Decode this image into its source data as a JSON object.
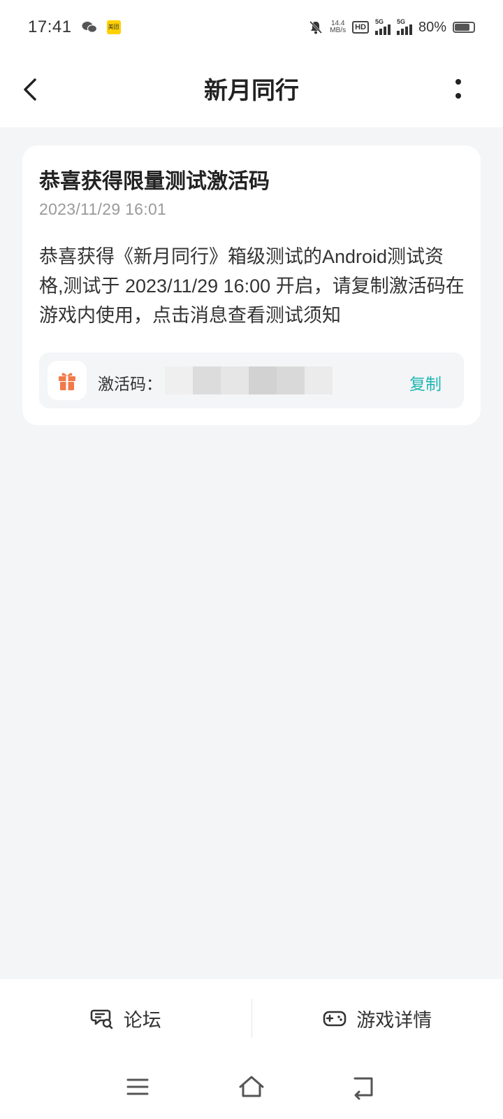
{
  "status_bar": {
    "time": "17:41",
    "app_icons": [
      "wechat-icon",
      "meituan-icon"
    ],
    "meituan_label": "美团",
    "net_speed_value": "14.4",
    "net_speed_unit": "MB/s",
    "hd_label": "HD",
    "signal_1_label": "5G",
    "signal_2_label": "5G",
    "battery": "80%",
    "battery_level": 0.8
  },
  "header": {
    "title": "新月同行",
    "back_icon": "back-arrow-icon",
    "more_icon": "more-vertical-icon"
  },
  "message": {
    "title": "恭喜获得限量测试激活码",
    "time": "2023/11/29  16:01",
    "body": "恭喜获得《新月同行》箱级测试的Android测试资格,测试于 2023/11/29  16:00 开启，请复制激活码在游戏内使用，点击消息查看测试须知",
    "code_label": "激活码：",
    "copy_label": "复制",
    "gift_icon": "gift-icon"
  },
  "colors": {
    "accent": "#1fb7b3",
    "gift": "#f07a4a",
    "background": "#f4f5f7"
  },
  "bottom_tabs": [
    {
      "label": "论坛",
      "icon": "forum-chat-icon"
    },
    {
      "label": "游戏详情",
      "icon": "gamepad-icon"
    }
  ],
  "system_nav": [
    "menu-icon",
    "home-icon",
    "back-icon"
  ]
}
